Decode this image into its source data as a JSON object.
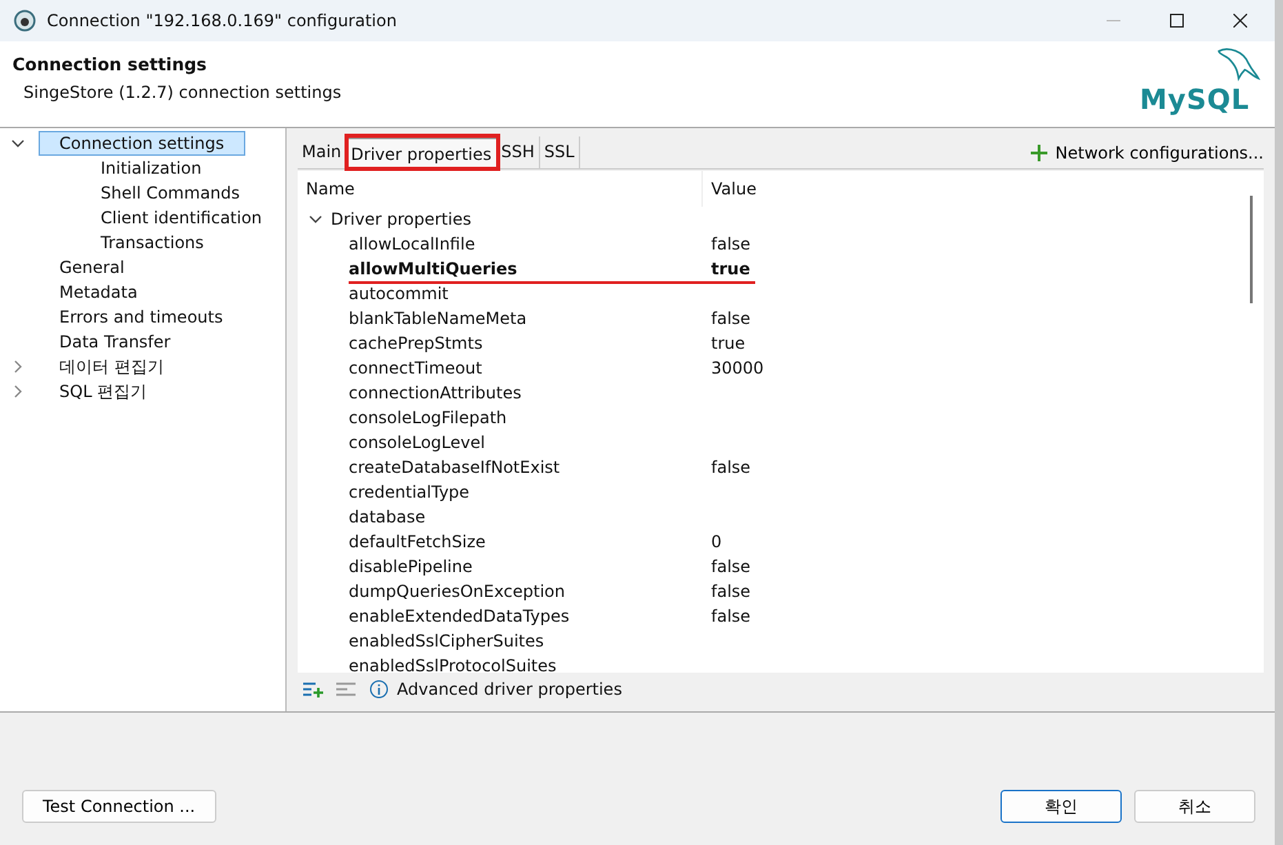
{
  "window": {
    "title": "Connection \"192.168.0.169\" configuration"
  },
  "header": {
    "title": "Connection settings",
    "subtitle": "SingeStore (1.2.7) connection settings",
    "logo": "MySQL"
  },
  "sidebar": {
    "items": [
      {
        "label": "Connection settings",
        "selected": true,
        "expanded": true,
        "children": [
          {
            "label": "Initialization",
            "selected": false
          },
          {
            "label": "Shell Commands",
            "selected": false
          },
          {
            "label": "Client identification",
            "selected": false
          },
          {
            "label": "Transactions",
            "selected": false
          }
        ]
      },
      {
        "label": "General",
        "selected": false
      },
      {
        "label": "Metadata",
        "selected": false
      },
      {
        "label": "Errors and timeouts",
        "selected": false
      },
      {
        "label": "Data Transfer",
        "selected": false
      },
      {
        "label": "데이터 편집기",
        "selected": false,
        "expanded": false
      },
      {
        "label": "SQL 편집기",
        "selected": false,
        "expanded": false
      }
    ]
  },
  "tabs": [
    {
      "label": "Main",
      "selected": false,
      "highlighted": false
    },
    {
      "label": "Driver properties",
      "selected": true,
      "highlighted": true
    },
    {
      "label": "SSH",
      "selected": false,
      "highlighted": false
    },
    {
      "label": "SSL",
      "selected": false,
      "highlighted": false
    }
  ],
  "network_button": "Network configurations...",
  "table": {
    "columns": [
      "Name",
      "Value"
    ],
    "group": {
      "label": "Driver properties",
      "expanded": true
    },
    "rows": [
      {
        "name": "allowLocalInfile",
        "value": "false",
        "highlighted": false
      },
      {
        "name": "allowMultiQueries",
        "value": "true",
        "highlighted": true
      },
      {
        "name": "autocommit",
        "value": "",
        "highlighted": false
      },
      {
        "name": "blankTableNameMeta",
        "value": "false",
        "highlighted": false
      },
      {
        "name": "cachePrepStmts",
        "value": "true",
        "highlighted": false
      },
      {
        "name": "connectTimeout",
        "value": "30000",
        "highlighted": false
      },
      {
        "name": "connectionAttributes",
        "value": "",
        "highlighted": false
      },
      {
        "name": "consoleLogFilepath",
        "value": "",
        "highlighted": false
      },
      {
        "name": "consoleLogLevel",
        "value": "",
        "highlighted": false
      },
      {
        "name": "createDatabaseIfNotExist",
        "value": "false",
        "highlighted": false
      },
      {
        "name": "credentialType",
        "value": "",
        "highlighted": false
      },
      {
        "name": "database",
        "value": "",
        "highlighted": false
      },
      {
        "name": "defaultFetchSize",
        "value": "0",
        "highlighted": false
      },
      {
        "name": "disablePipeline",
        "value": "false",
        "highlighted": false
      },
      {
        "name": "dumpQueriesOnException",
        "value": "false",
        "highlighted": false
      },
      {
        "name": "enableExtendedDataTypes",
        "value": "false",
        "highlighted": false
      },
      {
        "name": "enabledSslCipherSuites",
        "value": "",
        "highlighted": false
      },
      {
        "name": "enabledSslProtocolSuites",
        "value": "",
        "highlighted": false
      }
    ]
  },
  "advanced_link": "Advanced driver properties",
  "buttons": {
    "test": "Test Connection ...",
    "ok": "확인",
    "cancel": "취소"
  }
}
